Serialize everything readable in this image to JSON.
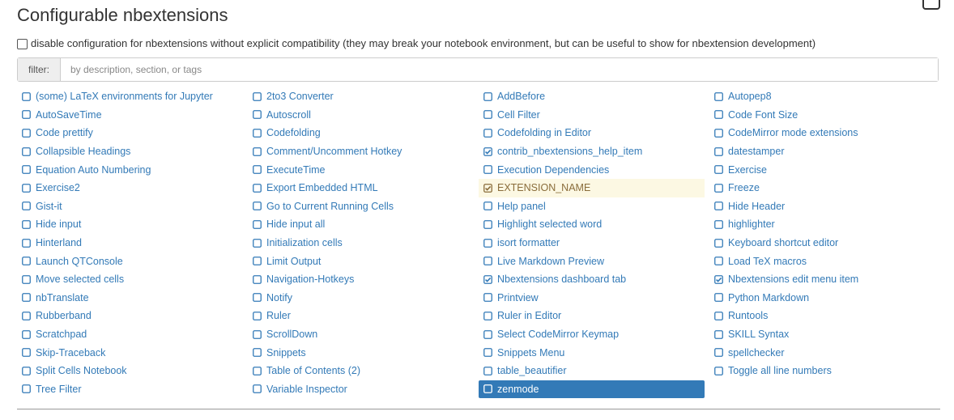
{
  "page": {
    "title": "Configurable nbextensions",
    "compat_label": "disable configuration for nbextensions without explicit compatibility (they may break your notebook environment, but can be useful to show for nbextension development)",
    "filter_label": "filter:",
    "filter_placeholder": "by description, section, or tags"
  },
  "extensions": [
    {
      "label": "(some) LaTeX environments for Jupyter",
      "checked": false,
      "state": ""
    },
    {
      "label": "2to3 Converter",
      "checked": false,
      "state": ""
    },
    {
      "label": "AddBefore",
      "checked": false,
      "state": ""
    },
    {
      "label": "Autopep8",
      "checked": false,
      "state": ""
    },
    {
      "label": "AutoSaveTime",
      "checked": false,
      "state": ""
    },
    {
      "label": "Autoscroll",
      "checked": false,
      "state": ""
    },
    {
      "label": "Cell Filter",
      "checked": false,
      "state": ""
    },
    {
      "label": "Code Font Size",
      "checked": false,
      "state": ""
    },
    {
      "label": "Code prettify",
      "checked": false,
      "state": ""
    },
    {
      "label": "Codefolding",
      "checked": false,
      "state": ""
    },
    {
      "label": "Codefolding in Editor",
      "checked": false,
      "state": ""
    },
    {
      "label": "CodeMirror mode extensions",
      "checked": false,
      "state": ""
    },
    {
      "label": "Collapsible Headings",
      "checked": false,
      "state": ""
    },
    {
      "label": "Comment/Uncomment Hotkey",
      "checked": false,
      "state": ""
    },
    {
      "label": "contrib_nbextensions_help_item",
      "checked": true,
      "state": ""
    },
    {
      "label": "datestamper",
      "checked": false,
      "state": ""
    },
    {
      "label": "Equation Auto Numbering",
      "checked": false,
      "state": ""
    },
    {
      "label": "ExecuteTime",
      "checked": false,
      "state": ""
    },
    {
      "label": "Execution Dependencies",
      "checked": false,
      "state": ""
    },
    {
      "label": "Exercise",
      "checked": false,
      "state": ""
    },
    {
      "label": "Exercise2",
      "checked": false,
      "state": ""
    },
    {
      "label": "Export Embedded HTML",
      "checked": false,
      "state": ""
    },
    {
      "label": "EXTENSION_NAME",
      "checked": true,
      "state": "highlight"
    },
    {
      "label": "Freeze",
      "checked": false,
      "state": ""
    },
    {
      "label": "Gist-it",
      "checked": false,
      "state": ""
    },
    {
      "label": "Go to Current Running Cells",
      "checked": false,
      "state": ""
    },
    {
      "label": "Help panel",
      "checked": false,
      "state": ""
    },
    {
      "label": "Hide Header",
      "checked": false,
      "state": ""
    },
    {
      "label": "Hide input",
      "checked": false,
      "state": ""
    },
    {
      "label": "Hide input all",
      "checked": false,
      "state": ""
    },
    {
      "label": "Highlight selected word",
      "checked": false,
      "state": ""
    },
    {
      "label": "highlighter",
      "checked": false,
      "state": ""
    },
    {
      "label": "Hinterland",
      "checked": false,
      "state": ""
    },
    {
      "label": "Initialization cells",
      "checked": false,
      "state": ""
    },
    {
      "label": "isort formatter",
      "checked": false,
      "state": ""
    },
    {
      "label": "Keyboard shortcut editor",
      "checked": false,
      "state": ""
    },
    {
      "label": "Launch QTConsole",
      "checked": false,
      "state": ""
    },
    {
      "label": "Limit Output",
      "checked": false,
      "state": ""
    },
    {
      "label": "Live Markdown Preview",
      "checked": false,
      "state": ""
    },
    {
      "label": "Load TeX macros",
      "checked": false,
      "state": ""
    },
    {
      "label": "Move selected cells",
      "checked": false,
      "state": ""
    },
    {
      "label": "Navigation-Hotkeys",
      "checked": false,
      "state": ""
    },
    {
      "label": "Nbextensions dashboard tab",
      "checked": true,
      "state": ""
    },
    {
      "label": "Nbextensions edit menu item",
      "checked": true,
      "state": ""
    },
    {
      "label": "nbTranslate",
      "checked": false,
      "state": ""
    },
    {
      "label": "Notify",
      "checked": false,
      "state": ""
    },
    {
      "label": "Printview",
      "checked": false,
      "state": ""
    },
    {
      "label": "Python Markdown",
      "checked": false,
      "state": ""
    },
    {
      "label": "Rubberband",
      "checked": false,
      "state": ""
    },
    {
      "label": "Ruler",
      "checked": false,
      "state": ""
    },
    {
      "label": "Ruler in Editor",
      "checked": false,
      "state": ""
    },
    {
      "label": "Runtools",
      "checked": false,
      "state": ""
    },
    {
      "label": "Scratchpad",
      "checked": false,
      "state": ""
    },
    {
      "label": "ScrollDown",
      "checked": false,
      "state": ""
    },
    {
      "label": "Select CodeMirror Keymap",
      "checked": false,
      "state": ""
    },
    {
      "label": "SKILL Syntax",
      "checked": false,
      "state": ""
    },
    {
      "label": "Skip-Traceback",
      "checked": false,
      "state": ""
    },
    {
      "label": "Snippets",
      "checked": false,
      "state": ""
    },
    {
      "label": "Snippets Menu",
      "checked": false,
      "state": ""
    },
    {
      "label": "spellchecker",
      "checked": false,
      "state": ""
    },
    {
      "label": "Split Cells Notebook",
      "checked": false,
      "state": ""
    },
    {
      "label": "Table of Contents (2)",
      "checked": false,
      "state": ""
    },
    {
      "label": "table_beautifier",
      "checked": false,
      "state": ""
    },
    {
      "label": "Toggle all line numbers",
      "checked": false,
      "state": ""
    },
    {
      "label": "Tree Filter",
      "checked": false,
      "state": ""
    },
    {
      "label": "Variable Inspector",
      "checked": false,
      "state": ""
    },
    {
      "label": "zenmode",
      "checked": false,
      "state": "selected"
    }
  ]
}
